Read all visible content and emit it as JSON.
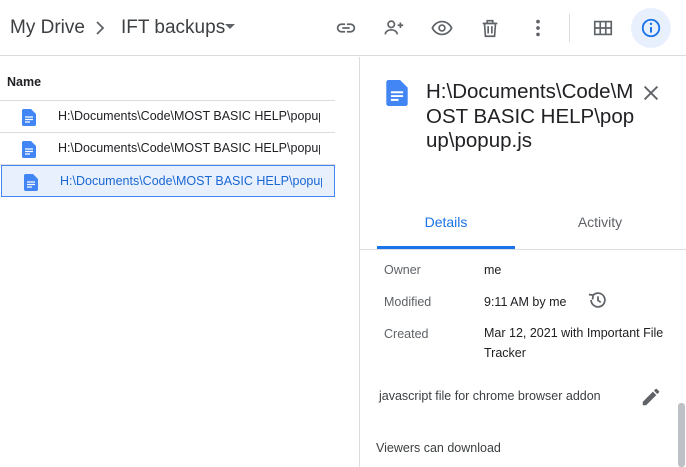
{
  "breadcrumb": {
    "root": "My Drive",
    "current": "IFT backups"
  },
  "toolbar": {
    "icons": [
      "link-icon",
      "add-person-icon",
      "eye-icon",
      "trash-icon",
      "more-vert-icon",
      "grid-view-icon",
      "info-icon"
    ]
  },
  "list": {
    "column_header": "Name",
    "files": [
      {
        "name": "H:\\Documents\\Code\\MOST BASIC HELP\\popup\\popup.js",
        "selected": false
      },
      {
        "name": "H:\\Documents\\Code\\MOST BASIC HELP\\popup\\popup.js",
        "selected": false
      },
      {
        "name": "H:\\Documents\\Code\\MOST BASIC HELP\\popup\\popup.js",
        "selected": true
      }
    ]
  },
  "details": {
    "title": "H:\\Documents\\Code\\MOST BASIC HELP\\popup\\popup.js",
    "tabs": {
      "details": "Details",
      "activity": "Activity"
    },
    "owner_label": "Owner",
    "owner_value": "me",
    "modified_label": "Modified",
    "modified_value": "9:11 AM by me",
    "created_label": "Created",
    "created_value": "Mar 12, 2021 with Important File Tracker",
    "description": "javascript file for chrome browser addon",
    "viewers": "Viewers can download"
  },
  "colors": {
    "accent": "#1a73e8",
    "doc_icon": "#4285f4",
    "selected_bg": "#e8f0fe"
  }
}
